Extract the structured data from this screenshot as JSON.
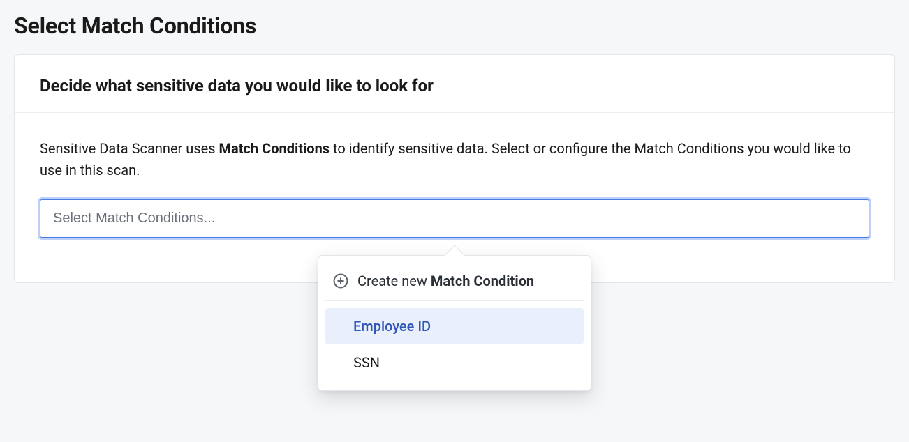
{
  "page": {
    "title": "Select Match Conditions"
  },
  "card": {
    "header_title": "Decide what sensitive data you would like to look for",
    "description_pre": "Sensitive Data Scanner uses ",
    "description_bold": "Match Conditions",
    "description_post": " to identify sensitive data. Select or configure the Match Conditions you would like to use in this scan."
  },
  "select": {
    "placeholder": "Select Match Conditions..."
  },
  "dropdown": {
    "create_pre": "Create new ",
    "create_bold": "Match Condition",
    "options": [
      {
        "label": "Employee ID",
        "highlight": true
      },
      {
        "label": "SSN",
        "highlight": false
      }
    ]
  }
}
